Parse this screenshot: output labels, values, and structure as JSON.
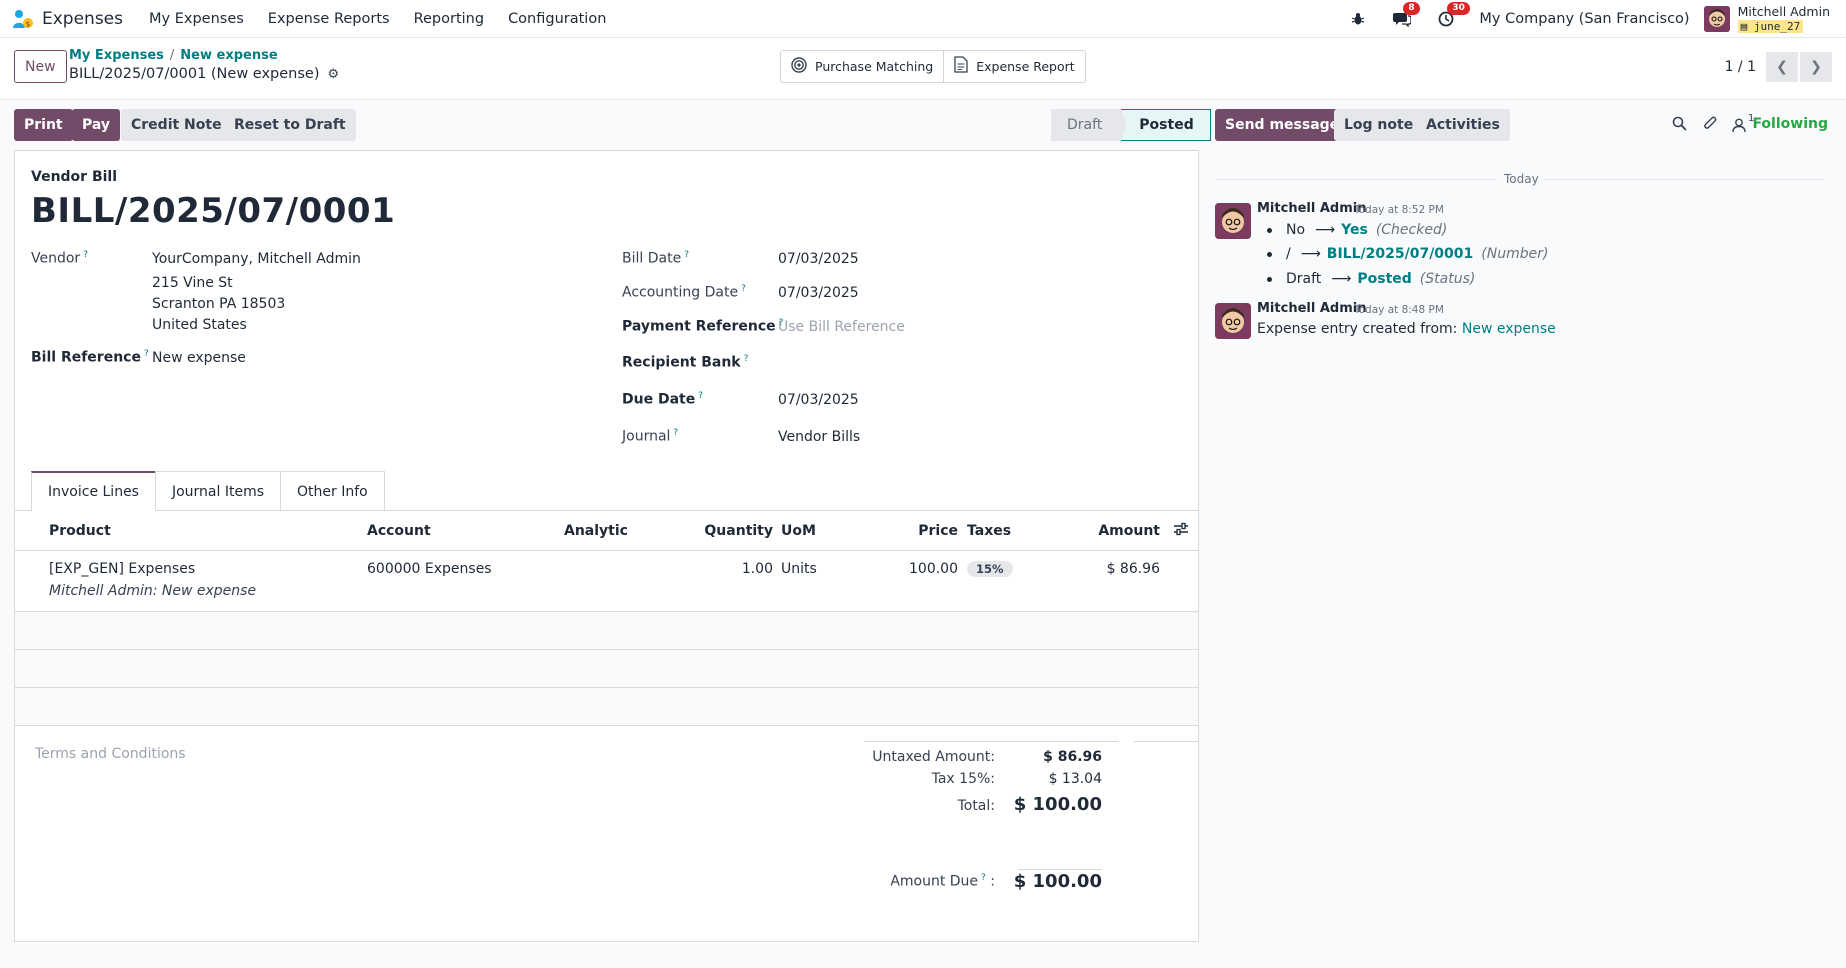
{
  "app": {
    "name": "Expenses"
  },
  "nav": {
    "menu": [
      "My Expenses",
      "Expense Reports",
      "Reporting",
      "Configuration"
    ]
  },
  "systray": {
    "messages_count": "8",
    "activities_count": "30",
    "company": "My Company (San Francisco)",
    "user_name": "Mitchell Admin",
    "database": "june_27"
  },
  "control": {
    "new_label": "New",
    "breadcrumb": [
      "My Expenses",
      "New expense"
    ],
    "record_name": "BILL/2025/07/0001 (New expense)",
    "smart_buttons": [
      {
        "label": "Purchase Matching",
        "icon": "target-icon"
      },
      {
        "label": "Expense Report",
        "icon": "document-icon"
      }
    ],
    "pager": "1 / 1"
  },
  "actions": {
    "print": "Print",
    "pay": "Pay",
    "credit_note": "Credit Note",
    "reset_to_draft": "Reset to Draft"
  },
  "status": {
    "steps": [
      "Draft",
      "Posted"
    ],
    "current": "Posted"
  },
  "form": {
    "doc_type": "Vendor Bill",
    "number": "BILL/2025/07/0001",
    "vendor_label": "Vendor",
    "vendor_name": "YourCompany, Mitchell Admin",
    "vendor_address": [
      "215 Vine St",
      "Scranton PA 18503",
      "United States"
    ],
    "bill_reference_label": "Bill Reference",
    "bill_reference": "New expense",
    "bill_date_label": "Bill Date",
    "bill_date": "07/03/2025",
    "accounting_date_label": "Accounting Date",
    "accounting_date": "07/03/2025",
    "payment_reference_label": "Payment Reference",
    "payment_reference_placeholder": "Use Bill Reference",
    "recipient_bank_label": "Recipient Bank",
    "due_date_label": "Due Date",
    "due_date": "07/03/2025",
    "journal_label": "Journal",
    "journal": "Vendor Bills",
    "tabs": [
      "Invoice Lines",
      "Journal Items",
      "Other Info"
    ],
    "columns": {
      "product": "Product",
      "account": "Account",
      "analytic": "Analytic",
      "quantity": "Quantity",
      "uom": "UoM",
      "price": "Price",
      "taxes": "Taxes",
      "amount": "Amount"
    },
    "lines": [
      {
        "product": "[EXP_GEN] Expenses",
        "description": "Mitchell Admin: New expense",
        "account": "600000 Expenses",
        "analytic": "",
        "quantity": "1.00",
        "uom": "Units",
        "price": "100.00",
        "tax": "15%",
        "amount": "$ 86.96"
      }
    ],
    "terms_placeholder": "Terms and Conditions",
    "totals": {
      "untaxed_label": "Untaxed Amount:",
      "untaxed": "$ 86.96",
      "tax_label": "Tax 15%:",
      "tax": "$ 13.04",
      "total_label": "Total:",
      "total": "$ 100.00",
      "amount_due_label": "Amount Due",
      "amount_due": "$ 100.00"
    }
  },
  "chatter": {
    "send_message": "Send message",
    "log_note": "Log note",
    "activities": "Activities",
    "followers_count": "1",
    "following": "Following",
    "day": "Today",
    "messages": [
      {
        "author": "Mitchell Admin",
        "time": "Today at 8:52 PM",
        "changes": [
          {
            "old": "No",
            "new": "Yes",
            "field": "(Checked)"
          },
          {
            "old": "/",
            "new": "BILL/2025/07/0001",
            "field": "(Number)"
          },
          {
            "old": "Draft",
            "new": "Posted",
            "field": "(Status)"
          }
        ]
      },
      {
        "author": "Mitchell Admin",
        "time": "Today at 8:48 PM",
        "body_prefix": "Expense entry created from:",
        "body_link": "New expense"
      }
    ]
  },
  "colors": {
    "brand": "#714b67",
    "link": "#017e84",
    "badge": "#dc2626",
    "following": "#28a745"
  }
}
